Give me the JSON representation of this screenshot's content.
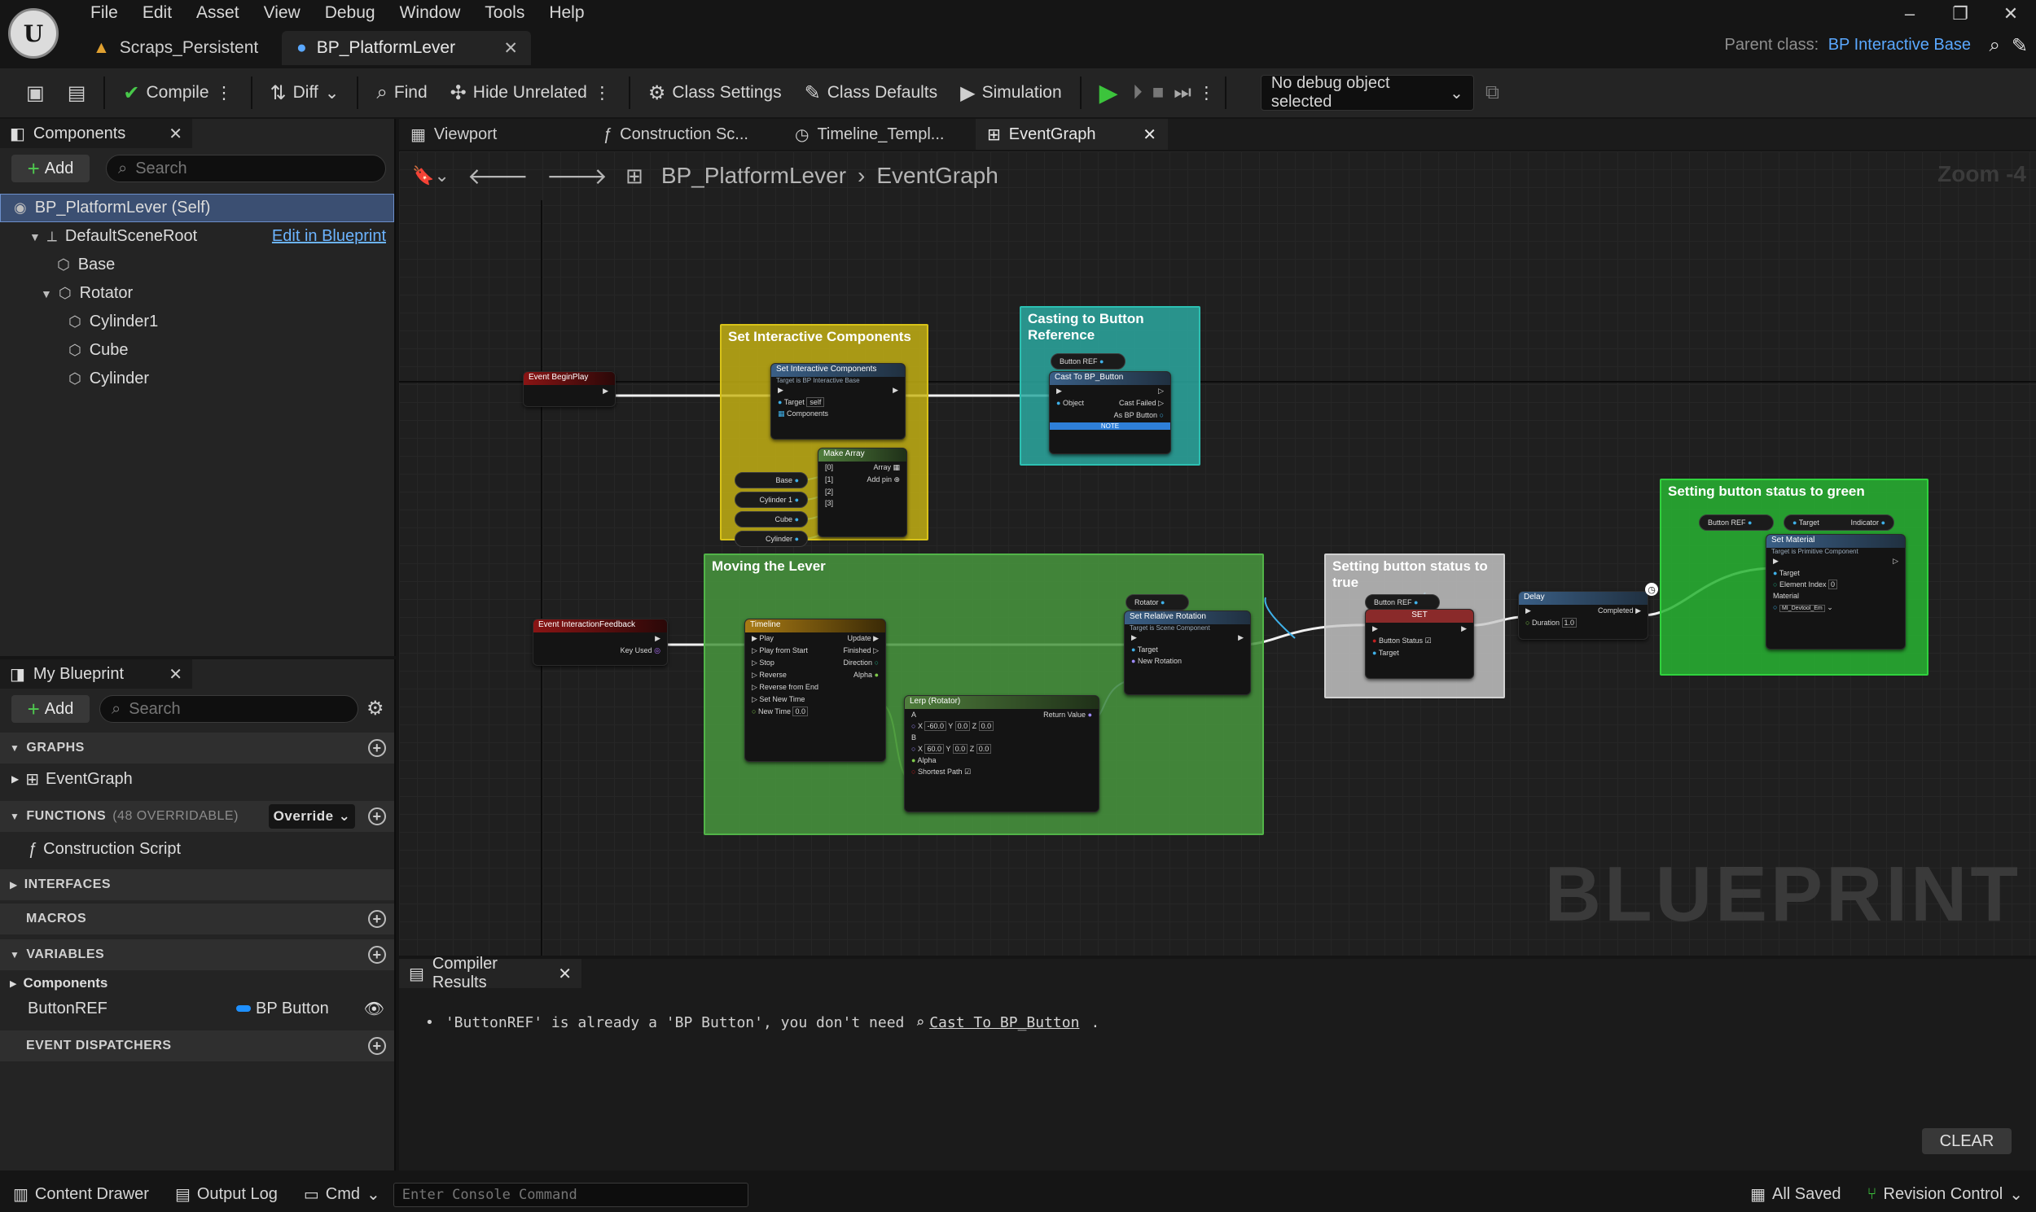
{
  "menu": [
    "File",
    "Edit",
    "Asset",
    "View",
    "Debug",
    "Window",
    "Tools",
    "Help"
  ],
  "doc_tabs": [
    {
      "label": "Scraps_Persistent"
    },
    {
      "label": "BP_PlatformLever"
    }
  ],
  "parent_class": {
    "label": "Parent class:",
    "value": "BP Interactive Base"
  },
  "toolbar": {
    "compile": "Compile",
    "diff": "Diff",
    "find": "Find",
    "hide_unrelated": "Hide Unrelated",
    "class_settings": "Class Settings",
    "class_defaults": "Class Defaults",
    "simulation": "Simulation",
    "debug_select": "No debug object selected"
  },
  "components_panel": {
    "title": "Components",
    "add": "Add",
    "search_placeholder": "Search",
    "tree": [
      {
        "label": "BP_PlatformLever (Self)"
      },
      {
        "label": "DefaultSceneRoot"
      },
      {
        "label": "Base"
      },
      {
        "label": "Rotator"
      },
      {
        "label": "Cylinder1"
      },
      {
        "label": "Cube"
      },
      {
        "label": "Cylinder"
      }
    ],
    "edit_in_blueprint": "Edit in Blueprint"
  },
  "my_blueprint": {
    "title": "My Blueprint",
    "add": "Add",
    "search_placeholder": "Search",
    "graphs_header": "GRAPHS",
    "event_graph": "EventGraph",
    "functions_header": "FUNCTIONS",
    "functions_sub": "(48 OVERRIDABLE)",
    "override": "Override",
    "construction_script": "Construction Script",
    "interfaces_header": "INTERFACES",
    "macros_header": "MACROS",
    "variables_header": "VARIABLES",
    "components_cat": "Components",
    "var_name": "ButtonREF",
    "var_type": "BP Button",
    "dispatchers_header": "EVENT DISPATCHERS"
  },
  "editor_tabs": [
    "Viewport",
    "Construction Sc...",
    "Timeline_Templ...",
    "EventGraph"
  ],
  "breadcrumb": {
    "blueprint": "BP_PlatformLever",
    "graph": "EventGraph"
  },
  "zoom": "Zoom -4",
  "watermark": "BLUEPRINT",
  "comments": {
    "set_components": "Set Interactive Components",
    "casting": "Casting to Button Reference",
    "moving_lever": "Moving the Lever",
    "button_true": "Setting button status to true",
    "button_green": "Setting button status to green"
  },
  "nodes": {
    "begin_play": "Event BeginPlay",
    "set_interactive": "Set Interactive Components",
    "set_interactive_sub": "Target is BP Interactive Base",
    "target_self": "Target",
    "self": "self",
    "components_pin": "Components",
    "make_array": "Make Array",
    "array": "Array",
    "add_pin": "Add pin",
    "idx0": "[0]",
    "idx1": "[1]",
    "idx2": "[2]",
    "idx3": "[3]",
    "base": "Base",
    "cylinder1": "Cylinder 1",
    "cube": "Cube",
    "cylinder": "Cylinder",
    "button_ref": "Button REF",
    "cast_to": "Cast To BP_Button",
    "object": "Object",
    "cast_failed": "Cast Failed",
    "as_bp_button": "As BP Button",
    "note": "NOTE",
    "interaction_feedback": "Event InteractionFeedback",
    "key_used": "Key Used",
    "timeline": "Timeline",
    "play": "Play",
    "play_from_start": "Play from Start",
    "stop": "Stop",
    "reverse": "Reverse",
    "reverse_from_end": "Reverse from End",
    "set_new_time": "Set New Time",
    "new_time": "New Time",
    "new_time_val": "0.0",
    "update": "Update",
    "finished": "Finished",
    "direction": "Direction",
    "alpha": "Alpha",
    "lerp": "Lerp (Rotator)",
    "a": "A",
    "b": "B",
    "return_value": "Return Value",
    "shortest_path": "Shortest Path",
    "a_x": "-60.0",
    "a_y": "0.0",
    "a_z": "0.0",
    "b_x": "60.0",
    "b_y": "0.0",
    "b_z": "0.0",
    "rotator": "Rotator",
    "set_rel_rot": "Set Relative Rotation",
    "set_rel_rot_sub": "Target is Scene Component",
    "target": "Target",
    "new_rotation": "New Rotation",
    "set": "SET",
    "button_status": "Button Status",
    "delay": "Delay",
    "completed": "Completed",
    "duration": "Duration",
    "duration_val": "1.0",
    "target2": "Target",
    "indicator": "Indicator",
    "set_material": "Set Material",
    "set_material_sub": "Target is Primitive Component",
    "element_index": "Element Index",
    "element_index_val": "0",
    "material": "Material",
    "material_val": "MI_Devtool_Em"
  },
  "compiler": {
    "tab": "Compiler Results",
    "message": "'ButtonREF' is already a 'BP Button', you don't need",
    "link": "Cast To BP_Button",
    "clear": "CLEAR"
  },
  "statusbar": {
    "content_drawer": "Content Drawer",
    "output_log": "Output Log",
    "cmd": "Cmd",
    "console_placeholder": "Enter Console Command",
    "all_saved": "All Saved",
    "revision_control": "Revision Control"
  },
  "colors": {
    "accent": "#5aa8ff",
    "exec_green": "#3cc43c",
    "selection": "#3b4f72"
  }
}
